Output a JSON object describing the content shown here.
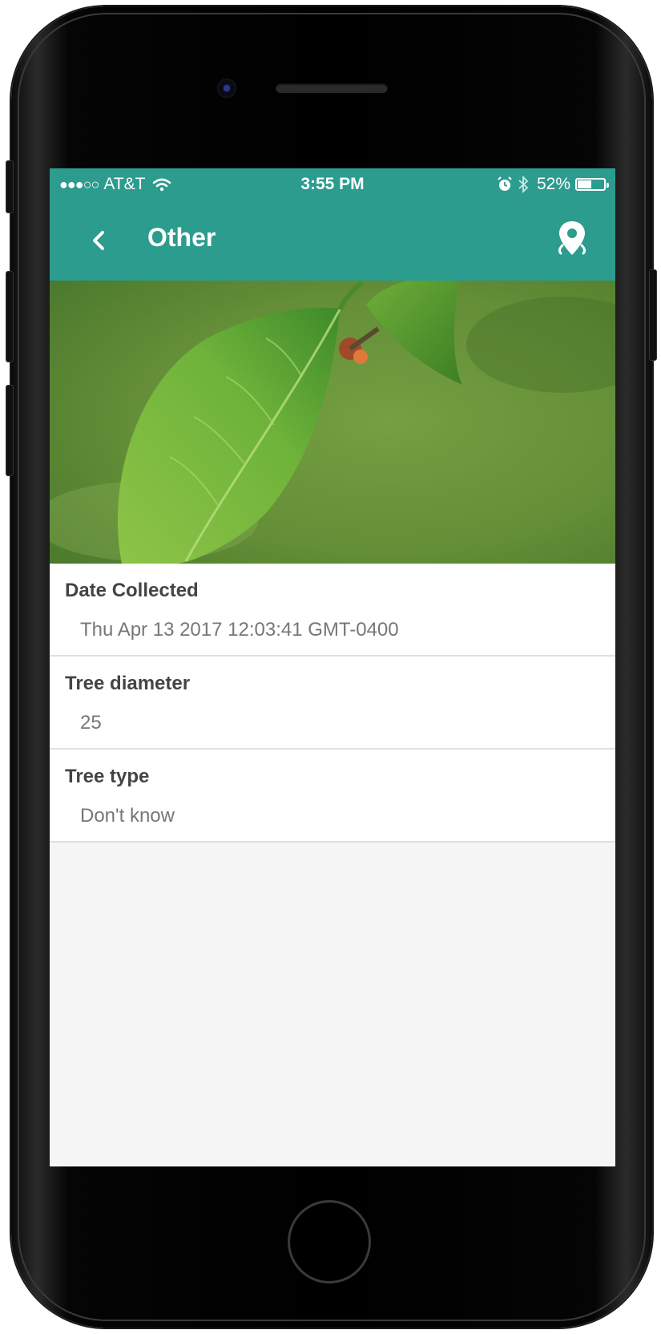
{
  "status_bar": {
    "signal_dots": "●●●○○",
    "carrier": "AT&T",
    "time": "3:55 PM",
    "battery_percent": "52%",
    "battery_level": 0.52
  },
  "nav": {
    "title": "Other"
  },
  "fields": [
    {
      "label": "Date Collected",
      "value": "Thu Apr 13 2017 12:03:41 GMT-0400"
    },
    {
      "label": "Tree diameter",
      "value": "25"
    },
    {
      "label": "Tree type",
      "value": "Don't know"
    }
  ],
  "colors": {
    "accent": "#2b9c8e",
    "background": "#f5f5f5"
  },
  "icons": [
    "wifi-icon",
    "alarm-icon",
    "bluetooth-icon",
    "battery-icon",
    "back-chevron-icon",
    "location-pin-icon"
  ]
}
